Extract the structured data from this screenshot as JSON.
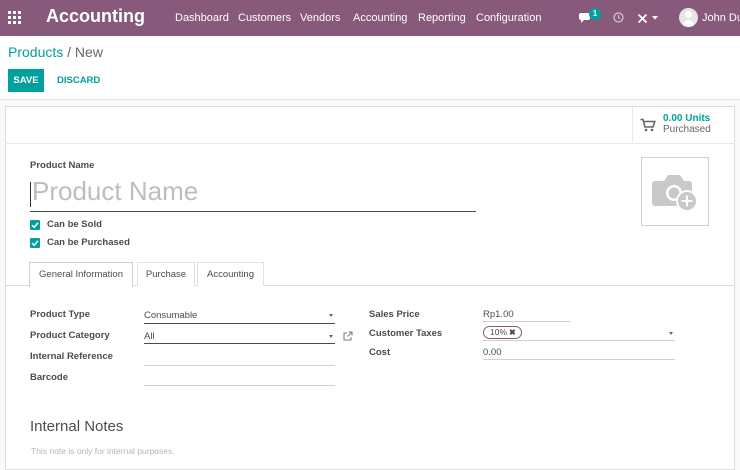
{
  "navbar": {
    "app_title": "Accounting",
    "menu": [
      "Dashboard",
      "Customers",
      "Vendors",
      "Accounting",
      "Reporting",
      "Configuration"
    ],
    "chat_badge": "1",
    "user_name": "John Due",
    "accent_color": "#875a7b"
  },
  "breadcrumb": {
    "parent": "Products",
    "separator": "/",
    "current": "New"
  },
  "actions": {
    "save_label": "SAVE",
    "discard_label": "DISCARD",
    "primary_color": "#00a09d"
  },
  "smart_button": {
    "value": "0.00 Units",
    "label": "Purchased",
    "icon": "cart-icon"
  },
  "product": {
    "name_label": "Product Name",
    "name_placeholder": "Product Name",
    "can_be_sold_label": "Can be Sold",
    "can_be_sold": true,
    "can_be_purchased_label": "Can be Purchased",
    "can_be_purchased": true,
    "image_icon": "camera-add-icon"
  },
  "tabs": [
    {
      "label": "General Information",
      "active": true
    },
    {
      "label": "Purchase",
      "active": false
    },
    {
      "label": "Accounting",
      "active": false
    }
  ],
  "general_info": {
    "product_type_label": "Product Type",
    "product_type_value": "Consumable",
    "product_category_label": "Product Category",
    "product_category_value": "All",
    "internal_reference_label": "Internal Reference",
    "internal_reference_value": "",
    "barcode_label": "Barcode",
    "barcode_value": "",
    "sales_price_label": "Sales Price",
    "sales_price_value": "Rp1.00",
    "customer_taxes_label": "Customer Taxes",
    "customer_taxes_tags": [
      "10%"
    ],
    "cost_label": "Cost",
    "cost_value": "0.00"
  },
  "notes": {
    "title": "Internal Notes",
    "placeholder": "This note is only for internal purposes."
  }
}
